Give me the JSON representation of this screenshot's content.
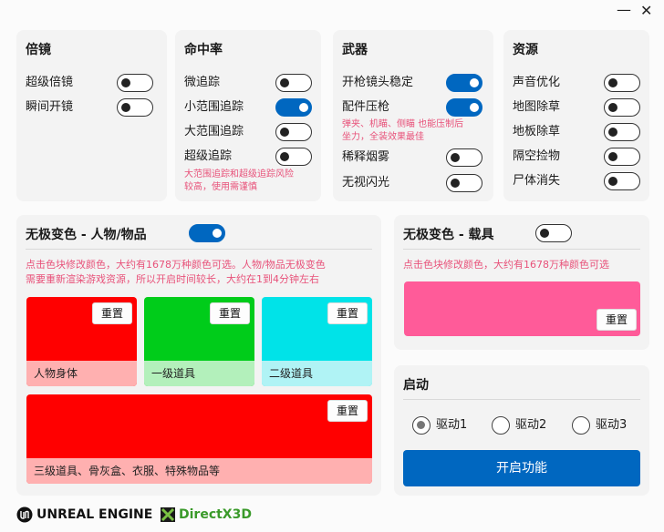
{
  "window": {
    "minimize": "—",
    "close": "✕"
  },
  "scope": {
    "title": "倍镜",
    "items": [
      {
        "label": "超级倍镜",
        "on": false
      },
      {
        "label": "瞬间开镜",
        "on": false
      }
    ]
  },
  "hitrate": {
    "title": "命中率",
    "items": [
      {
        "label": "微追踪",
        "on": false
      },
      {
        "label": "小范围追踪",
        "on": true
      },
      {
        "label": "大范围追踪",
        "on": false
      },
      {
        "label": "超级追踪",
        "on": false
      }
    ],
    "note_line1": "大范围追踪和超级追踪风险",
    "note_line2": "较高，使用需谨慎"
  },
  "weapon": {
    "title": "武器",
    "items": [
      {
        "label": "开枪镜头稳定",
        "on": true
      },
      {
        "label": "配件压枪",
        "on": true
      },
      {
        "label": "稀释烟雾",
        "on": false
      },
      {
        "label": "无视闪光",
        "on": false
      }
    ],
    "note_line1": "弹夹、机瞄、侧瞄 也能压制后",
    "note_line2": "坐力，全装效果最佳"
  },
  "resources": {
    "title": "资源",
    "items": [
      {
        "label": "声音优化",
        "on": false
      },
      {
        "label": "地图除草",
        "on": false
      },
      {
        "label": "地板除草",
        "on": false
      },
      {
        "label": "隔空捡物",
        "on": false
      },
      {
        "label": "尸体消失",
        "on": false
      }
    ]
  },
  "color_person": {
    "title": "无极变色 - 人物/物品",
    "on": true,
    "note_line1": "点击色块修改颜色，大约有1678万种颜色可选。人物/物品无极变色",
    "note_line2": "需要重新渲染游戏资源，所以开启时间较长，大约在1到4分钟左右",
    "reset_label": "重置",
    "blocks": [
      {
        "label": "人物身体",
        "color": "#ff0000",
        "label_bg": "#ffb0b0"
      },
      {
        "label": "一级道具",
        "color": "#00cc1a",
        "label_bg": "#b3f0bb"
      },
      {
        "label": "二级道具",
        "color": "#00e3e8",
        "label_bg": "#b0f3f5"
      },
      {
        "label": "三级道具、骨灰盒、衣服、特殊物品等",
        "color": "#ff0000",
        "label_bg": "#ffb0b0"
      }
    ]
  },
  "color_vehicle": {
    "title": "无极变色 - 载具",
    "on": false,
    "note": "点击色块修改颜色，大约有1678万种颜色可选",
    "reset_label": "重置",
    "color": "#ff5b99"
  },
  "start": {
    "title": "启动",
    "drivers": [
      {
        "label": "驱动1",
        "selected": true
      },
      {
        "label": "驱动2",
        "selected": false
      },
      {
        "label": "驱动3",
        "selected": false
      }
    ],
    "button_label": "开启功能"
  },
  "footer": {
    "unreal": "UNREAL ENGINE",
    "directx": "DirectX3D"
  }
}
